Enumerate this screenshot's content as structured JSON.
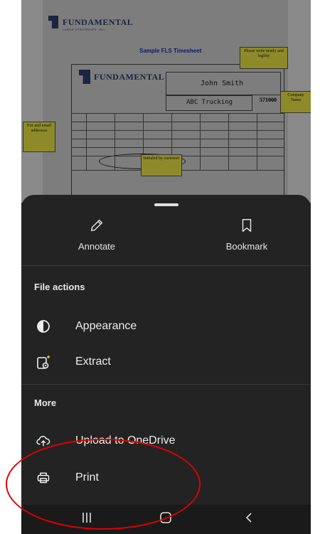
{
  "document": {
    "logo_text": "FUNDAMENTAL",
    "logo_subtext": "LABOR STRATEGIES, INC.",
    "title": "Sample FLS Timesheet",
    "notes": {
      "write_neatly": "Please write neatly and legibly",
      "company_name": "Company Name",
      "fax_email": "Fax and email addresses",
      "initialed": "Initialed by customer"
    },
    "employee_name": "John Smith",
    "company": "ABC Trucking",
    "number": "571000"
  },
  "sheet": {
    "top_actions": [
      {
        "label": "Annotate",
        "icon": "pencil-icon"
      },
      {
        "label": "Bookmark",
        "icon": "bookmark-icon"
      }
    ],
    "file_actions_header": "File actions",
    "file_actions": [
      {
        "label": "Appearance",
        "icon": "contrast-icon"
      },
      {
        "label": "Extract",
        "icon": "extract-icon"
      }
    ],
    "more_header": "More",
    "more_actions": [
      {
        "label": "Upload to OneDrive",
        "icon": "cloud-upload-icon"
      },
      {
        "label": "Print",
        "icon": "printer-icon"
      }
    ]
  },
  "navbar": {
    "recents_icon": "recents-icon",
    "home_icon": "home-icon",
    "back_icon": "back-icon"
  },
  "colors": {
    "sheet_bg": "#232323",
    "text": "#ededed",
    "annotation_red": "#e00000"
  }
}
